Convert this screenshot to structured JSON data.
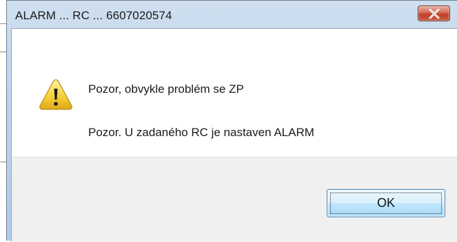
{
  "dialog": {
    "title": "ALARM ... RC ... 6607020574",
    "close_icon": "close-icon",
    "warning_icon": "warning-icon",
    "messages": [
      "Pozor, obvykle problém se ZP",
      "Pozor. U zadaného RC je nastaven ALARM"
    ],
    "ok_label": "OK"
  },
  "colors": {
    "close_button": "#c7452f",
    "ok_button": "#bee6fd",
    "warning_yellow": "#f5d23a"
  }
}
